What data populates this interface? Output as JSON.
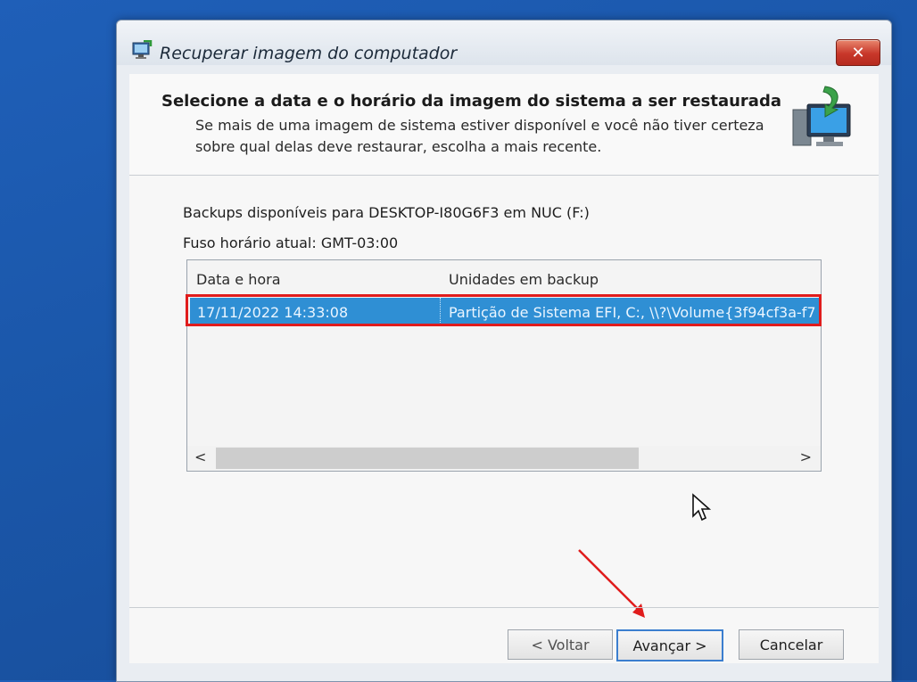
{
  "window": {
    "title": "Recuperar imagem do computador",
    "close_symbol": "✕"
  },
  "header": {
    "heading": "Selecione a data e o horário da imagem do sistema a ser restaurada",
    "description": "Se mais de uma imagem de sistema estiver disponível e você não tiver certeza sobre qual delas deve restaurar, escolha a mais recente."
  },
  "backups_label": "Backups disponíveis para DESKTOP-I80G6F3 em NUC (F:)",
  "timezone_label": "Fuso horário atual: GMT-03:00",
  "table": {
    "columns": [
      "Data e hora",
      "Unidades em backup"
    ],
    "rows": [
      {
        "date": "17/11/2022 14:33:08",
        "drives": "Partição de Sistema EFI, C:, \\\\?\\Volume{3f94cf3a-f7"
      }
    ]
  },
  "scroll": {
    "left": "<",
    "right": ">"
  },
  "buttons": {
    "back": "< Voltar",
    "next": "Avançar >",
    "cancel": "Cancelar"
  },
  "colors": {
    "selection": "#2f8fd4",
    "highlight": "#e01c1c",
    "desktop": "#1a56a8"
  }
}
